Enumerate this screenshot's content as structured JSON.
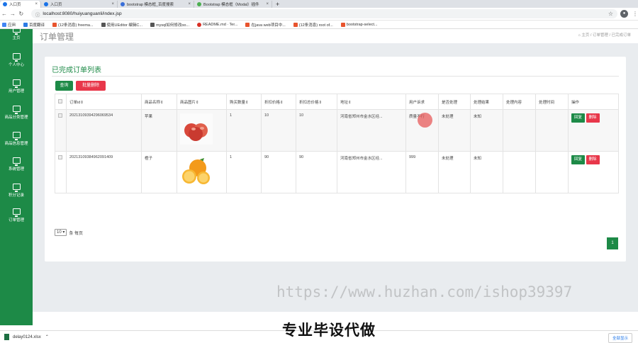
{
  "browser": {
    "tabs": [
      {
        "title": "入口页",
        "color": "#1a73e8",
        "active": true
      },
      {
        "title": "入口页",
        "color": "#1a73e8",
        "active": false
      },
      {
        "title": "bootstrap 模态框_百度搜索",
        "color": "#3a6fd8",
        "active": false
      },
      {
        "title": "Bootstrap 模态框（Modal）插件",
        "color": "#4caf50",
        "active": false
      }
    ],
    "new_tab": "+",
    "url": "localhost:8080/huiyuanguanli/index.jsp",
    "bookmarks": [
      {
        "label": "应用",
        "color": "#4285f4"
      },
      {
        "label": "百度翻译",
        "color": "#2d7be5"
      },
      {
        "label": "(12条消息) freema...",
        "color": "#e8542e"
      },
      {
        "label": "使用UEditor 编辑C...",
        "color": "#555555"
      },
      {
        "label": "mysql如何修改oo...",
        "color": "#555555"
      },
      {
        "label": "README.md · Ter...",
        "color": "#d93025"
      },
      {
        "label": "在java web项目中...",
        "color": "#e8542e"
      },
      {
        "label": "(12条消息) root of...",
        "color": "#e8542e"
      },
      {
        "label": "bootstrap-select...",
        "color": "#e8542e"
      }
    ]
  },
  "sidebar": {
    "items": [
      {
        "label": "主页"
      },
      {
        "label": "个人中心"
      },
      {
        "label": "用户管理"
      },
      {
        "label": "商品分类管理"
      },
      {
        "label": "商品信息管理"
      },
      {
        "label": "系统管理"
      },
      {
        "label": "积分记录"
      },
      {
        "label": "订单管理"
      }
    ]
  },
  "page": {
    "title": "订单管理",
    "breadcrumb": "主页 / 订单管理 / 已完成订单"
  },
  "card": {
    "title": "已完成订单列表",
    "query_button": "查询",
    "batch_delete_button": "批量删除"
  },
  "table": {
    "headers": [
      "订单id",
      "商品名称",
      "商品图片",
      "购买数量",
      "折扣价格",
      "折扣总价格",
      "地址",
      "用户诉求",
      "是否处理",
      "处理结果",
      "处理内容",
      "处理时间",
      "操作"
    ],
    "rows": [
      {
        "order_id": "20213109394296069534",
        "name": "苹果",
        "image": "apple",
        "qty": "1",
        "price": "10",
        "total": "10",
        "address": "河南省郑州市金水区经...",
        "request": "质量不行",
        "handled": "未处理",
        "result": "未知",
        "content": "",
        "time": "",
        "reply": "回复",
        "delete": "删除"
      },
      {
        "order_id": "20213109384962091409",
        "name": "橙子",
        "image": "orange",
        "qty": "1",
        "price": "90",
        "total": "90",
        "address": "河南省郑州市金水区经...",
        "request": "999",
        "handled": "未处理",
        "result": "未知",
        "content": "",
        "time": "",
        "reply": "回复",
        "delete": "删除"
      }
    ]
  },
  "pagination": {
    "page_size": "10",
    "per_page_label": "条 每页",
    "current_page": "1"
  },
  "footer": "",
  "downloads": {
    "file": "delay0124.xlsx",
    "show_all": "全部显示"
  },
  "overlay": {
    "watermark": "https://www.huzhan.com/ishop39397",
    "caption": "专业毕设代做"
  },
  "colors": {
    "primary": "#1d8a47",
    "danger": "#e8374a"
  }
}
